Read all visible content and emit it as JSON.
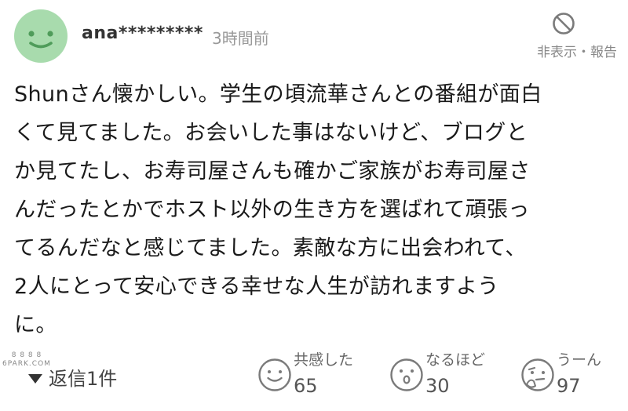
{
  "comment": {
    "username": "ana*********",
    "timestamp": "3時間前",
    "hide_report_label": "非表示・報告",
    "body_lines": [
      "Shunさん懐かしい。学生の頃流華さんとの番組が面白",
      "くて見てました。お会いした事はないけど、ブログと",
      "か見てたし、お寿司屋さんも確かご家族がお寿司屋さ",
      "んだったとかでホスト以外の生き方を選ばれて頑張っ",
      "てるんだなと感じてました。素敵な方に出会われて、",
      "2人にとって安心できる幸せな人生が訪れますよう",
      "に。"
    ]
  },
  "replies": {
    "label": "返信1件"
  },
  "reactions": [
    {
      "label": "共感した",
      "count": "65",
      "icon": "smile-face-icon"
    },
    {
      "label": "なるほど",
      "count": "30",
      "icon": "surprised-face-icon"
    },
    {
      "label": "うーん",
      "count": "97",
      "icon": "thinking-face-icon"
    }
  ],
  "watermark": {
    "line1": "8 8 8 8",
    "line2": "6PARK.COM"
  },
  "colors": {
    "avatar_bg": "#a8dbad",
    "avatar_face": "#4f9c5a",
    "icon_stroke": "#7a7a7a",
    "muted_text": "#999999"
  }
}
